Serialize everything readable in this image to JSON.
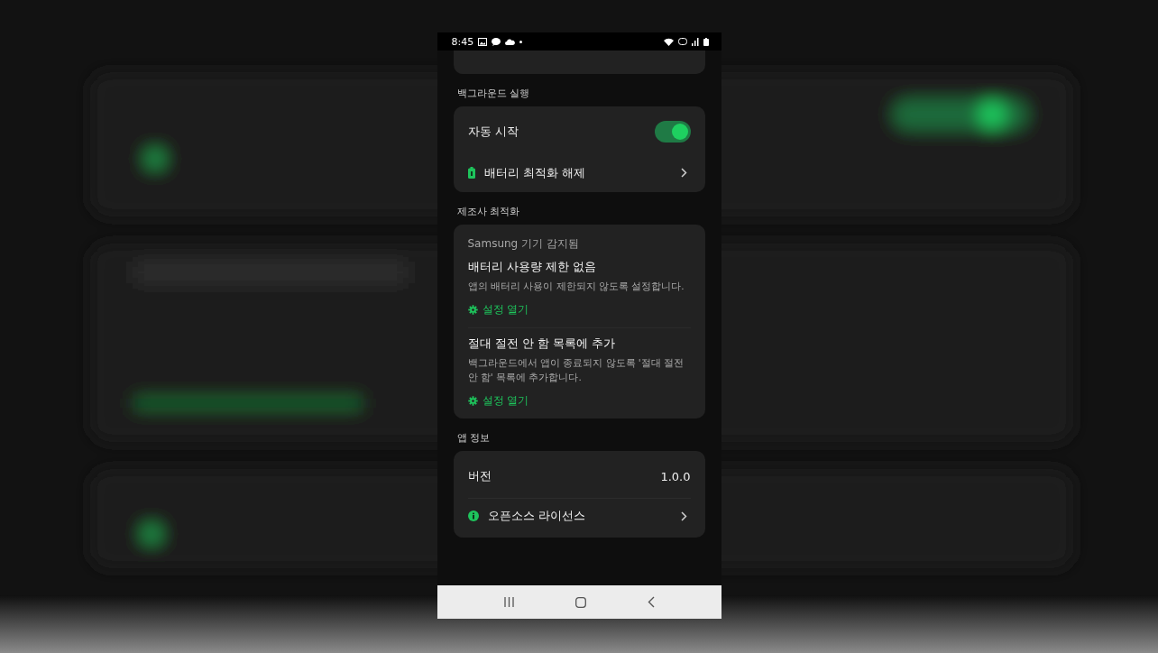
{
  "status_bar": {
    "time": "8:45"
  },
  "sections": [
    {
      "kind": "list",
      "title": "백그라운드 실행",
      "items": [
        {
          "kind": "toggle",
          "label": "자동 시작",
          "on": true
        },
        {
          "kind": "battery-link",
          "label": "배터리 최적화 해제"
        }
      ]
    },
    {
      "kind": "steps",
      "title": "제조사 최적화",
      "note": "Samsung 기기 감지됨",
      "steps": [
        {
          "title": "배터리 사용량 제한 없음",
          "description": "앱의 배터리 사용이 제한되지 않도록 설정합니다.",
          "action": "설정 열기"
        },
        {
          "title": "절대 절전 안 함 목록에 추가",
          "description": "백그라운드에서 앱이 종료되지 않도록 '절대 절전 안 함' 목록에 추가합니다.",
          "action": "설정 열기"
        }
      ]
    },
    {
      "kind": "list",
      "title": "앱 정보",
      "items": [
        {
          "kind": "value",
          "label": "버전",
          "value": "1.0.0"
        },
        {
          "kind": "info-link",
          "label": "오픈소스 라이선스"
        }
      ]
    }
  ]
}
